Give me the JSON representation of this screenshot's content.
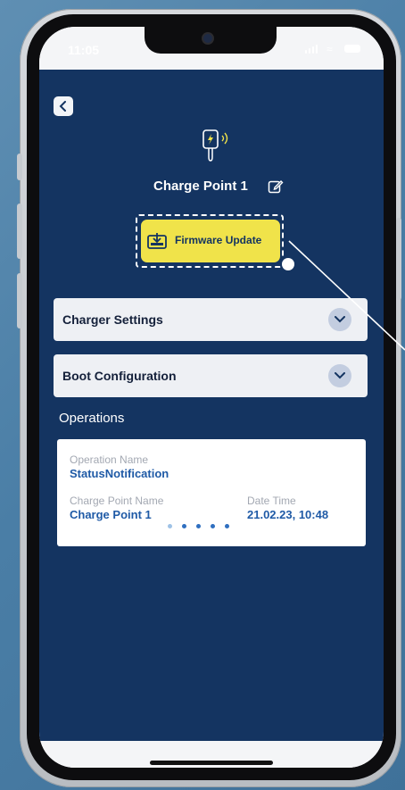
{
  "status_bar": {
    "time": "11:05"
  },
  "header": {
    "back_icon": "chevron-left-icon",
    "device_icon": "charger-wireless-icon",
    "title": "Charge Point 1",
    "edit_icon": "edit-icon"
  },
  "firmware": {
    "label": "Firmware Update",
    "icon": "firmware-download-icon"
  },
  "accordions": [
    {
      "label": "Charger Settings"
    },
    {
      "label": "Boot Configuration"
    }
  ],
  "operations": {
    "heading": "Operations",
    "card": {
      "operation_name_label": "Operation Name",
      "operation_name": "StatusNotification",
      "charge_point_name_label": "Charge Point Name",
      "charge_point_name": "Charge Point 1",
      "date_time_label": "Date Time",
      "date_time": "21.02.23, 10:48"
    }
  },
  "colors": {
    "app_background": "#143461",
    "accent_yellow": "#f0e34a",
    "value_blue": "#1f5aa6"
  }
}
